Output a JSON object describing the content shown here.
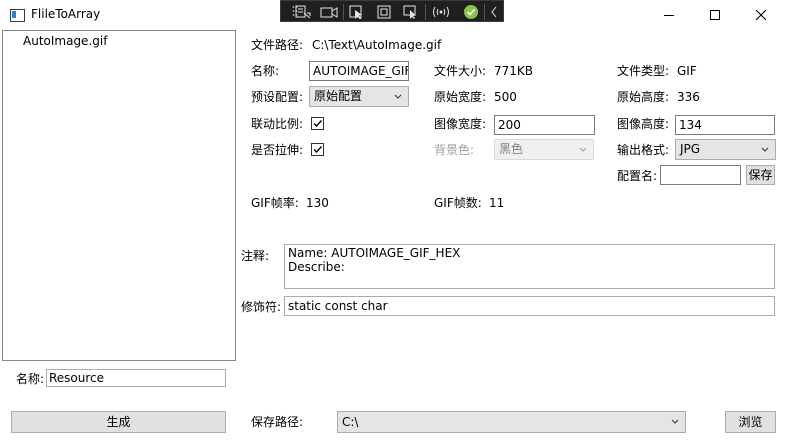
{
  "window": {
    "title": "FlileToArray",
    "controls": [
      "minimize",
      "maximize",
      "close"
    ]
  },
  "toolbar": {
    "icons": [
      "live-visual-tree-icon",
      "record-icon",
      "select-element-icon",
      "display-layout-adorners-icon",
      "track-focus-icon",
      "hot-reload-icon",
      "binding-check-icon",
      "collapse-chevron-icon"
    ]
  },
  "file_list": {
    "items": [
      "AutoImage.gif"
    ]
  },
  "info": {
    "path_label": "文件路径:",
    "path_value": "C:\\Text\\AutoImage.gif",
    "name_label": "名称:",
    "name_value": "AUTOIMAGE_GIF",
    "filesize_label": "文件大小:",
    "filesize_value": "771KB",
    "filetype_label": "文件类型:",
    "filetype_value": "GIF",
    "preset_label": "预设配置:",
    "preset_value": "原始配置",
    "orig_width_label": "原始宽度:",
    "orig_width_value": "500",
    "orig_height_label": "原始高度:",
    "orig_height_value": "336",
    "link_ratio_label": "联动比例:",
    "link_ratio_checked": true,
    "img_width_label": "图像宽度:",
    "img_width_value": "200",
    "img_height_label": "图像高度:",
    "img_height_value": "134",
    "stretch_label": "是否拉伸:",
    "stretch_checked": true,
    "bg_label": "背景色:",
    "bg_value": "黑色",
    "output_label": "输出格式:",
    "output_value": "JPG",
    "config_name_label": "配置名:",
    "config_name_value": "",
    "save_config_btn": "保存",
    "gif_rate_label": "GIF帧率:",
    "gif_rate_value": "130",
    "gif_frames_label": "GIF帧数:",
    "gif_frames_value": "11"
  },
  "comment": {
    "label": "注释:",
    "line1": "Name: AUTOIMAGE_GIF_HEX",
    "line2": "Describe:"
  },
  "modifier": {
    "label": "修饰符:",
    "value": "static const char"
  },
  "bottom": {
    "name_label": "名称",
    "name_value": "Resource",
    "generate_btn": "生成",
    "save_path_label": "保存路径:",
    "save_path_value": "C:\\",
    "browse_btn": "浏览"
  }
}
